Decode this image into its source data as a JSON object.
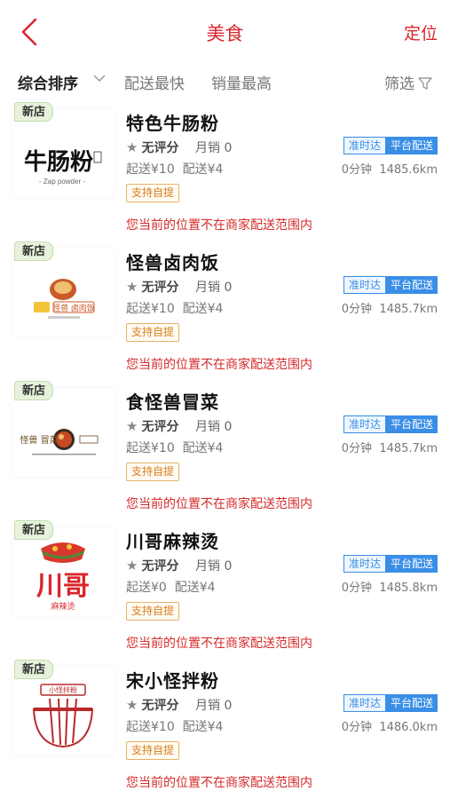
{
  "header": {
    "title": "美食",
    "locate_label": "定位"
  },
  "sortbar": {
    "items": [
      {
        "label": "综合排序",
        "active": true
      },
      {
        "label": "配送最快",
        "active": false
      },
      {
        "label": "销量最高",
        "active": false
      }
    ],
    "filter_label": "筛选"
  },
  "stores": [
    {
      "tag": "新店",
      "name": "特色牛肠粉",
      "rating": "无评分",
      "monthly_sales": "月销 0",
      "min_order": "起送¥10",
      "delivery_fee": "配送¥4",
      "time": "0分钟",
      "distance": "1485.6km",
      "badge_ontime": "准时达",
      "badge_platform": "平台配送",
      "pickup": "支持自提",
      "warning": "您当前的位置不在商家配送范围内",
      "logo_text": "牛肠粉",
      "logo_subtext": "- Zap powder -"
    },
    {
      "tag": "新店",
      "name": "怪兽卤肉饭",
      "rating": "无评分",
      "monthly_sales": "月销 0",
      "min_order": "起送¥10",
      "delivery_fee": "配送¥4",
      "time": "0分钟",
      "distance": "1485.7km",
      "badge_ontime": "准时达",
      "badge_platform": "平台配送",
      "pickup": "支持自提",
      "warning": "您当前的位置不在商家配送范围内",
      "logo_text": "怪兽 卤肉饭"
    },
    {
      "tag": "新店",
      "name": "食怪兽冒菜",
      "rating": "无评分",
      "monthly_sales": "月销 0",
      "min_order": "起送¥10",
      "delivery_fee": "配送¥4",
      "time": "0分钟",
      "distance": "1485.7km",
      "badge_ontime": "准时达",
      "badge_platform": "平台配送",
      "pickup": "支持自提",
      "warning": "您当前的位置不在商家配送范围内",
      "logo_text": "怪兽 冒菜"
    },
    {
      "tag": "新店",
      "name": "川哥麻辣烫",
      "rating": "无评分",
      "monthly_sales": "月销 0",
      "min_order": "起送¥0",
      "delivery_fee": "配送¥4",
      "time": "0分钟",
      "distance": "1485.8km",
      "badge_ontime": "准时达",
      "badge_platform": "平台配送",
      "pickup": "支持自提",
      "warning": "您当前的位置不在商家配送范围内",
      "logo_text": "川哥",
      "logo_subtext": "麻辣烫"
    },
    {
      "tag": "新店",
      "name": "宋小怪拌粉",
      "rating": "无评分",
      "monthly_sales": "月销 0",
      "min_order": "起送¥10",
      "delivery_fee": "配送¥4",
      "time": "0分钟",
      "distance": "1486.0km",
      "badge_ontime": "准时达",
      "badge_platform": "平台配送",
      "pickup": "支持自提",
      "warning": "您当前的位置不在商家配送范围内",
      "logo_text": "小怪拌粉"
    }
  ],
  "colors": {
    "accent": "#d8262c",
    "badge_blue": "#3a8ee6",
    "pickup_orange": "#d8801e",
    "warning_red": "#d52a2a"
  }
}
